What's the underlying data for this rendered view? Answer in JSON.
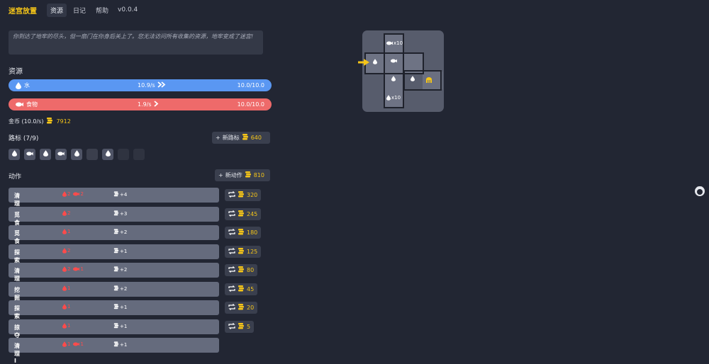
{
  "app": {
    "title": "迷宫放置",
    "version": "v0.0.4"
  },
  "nav": [
    {
      "label": "资源"
    },
    {
      "label": "日记"
    },
    {
      "label": "帮助"
    }
  ],
  "message": "你到达了地牢的尽头，但一扇门在你身后关上了。您无法访问所有收集的资源，地牢变成了迷宫!",
  "resources": {
    "heading": "资源",
    "water": {
      "label": "水",
      "rate": "10.9/s",
      "amount": "10.0/10.0",
      "fill": 1.0
    },
    "food": {
      "label": "食物",
      "rate": "1.9/s",
      "amount": "10.0/10.0",
      "fill": 1.0
    },
    "gold": {
      "label": "金币 (10.0/s)",
      "value": "7912"
    }
  },
  "markers": {
    "heading": "路标 (7/9)",
    "new_label": "新路标",
    "new_cost": "640",
    "slots": [
      "water",
      "fish",
      "water",
      "fish",
      "water",
      "empty",
      "water",
      "empty-dark",
      "empty-dark"
    ]
  },
  "actions": {
    "heading": "动作",
    "new_label": "新动作",
    "new_cost": "810",
    "items": [
      {
        "name": "清理 IX",
        "costs": [
          "2",
          "2"
        ],
        "gain": "+4",
        "upgrade": "320"
      },
      {
        "name": "觅食 VIII",
        "costs": [
          "2"
        ],
        "gain": "+3",
        "upgrade": "245"
      },
      {
        "name": "觅食 VII",
        "costs": [
          "1"
        ],
        "gain": "+2",
        "upgrade": "180"
      },
      {
        "name": "探索 VI",
        "costs": [
          "2"
        ],
        "gain": "+1",
        "upgrade": "125"
      },
      {
        "name": "清理 V",
        "costs": [
          "2",
          "1"
        ],
        "gain": "+2",
        "upgrade": "80"
      },
      {
        "name": "挖掘 IV",
        "costs": [
          "1"
        ],
        "gain": "+2",
        "upgrade": "45"
      },
      {
        "name": "探索 III",
        "costs": [
          "1"
        ],
        "gain": "+1",
        "upgrade": "20"
      },
      {
        "name": "掠夺 II",
        "costs": [
          "1"
        ],
        "gain": "+1",
        "upgrade": "5"
      },
      {
        "name": "清理 I",
        "costs": [
          "1",
          "1"
        ],
        "gain": "+1",
        "upgrade": ""
      }
    ]
  },
  "map": {
    "label_top": "x10",
    "label_bottom": "x10"
  },
  "colors": {
    "accent": "#f5c518",
    "water": "#5a97f2",
    "food": "#ee6a6a",
    "panel": "#656b7d",
    "bg": "#222633"
  }
}
